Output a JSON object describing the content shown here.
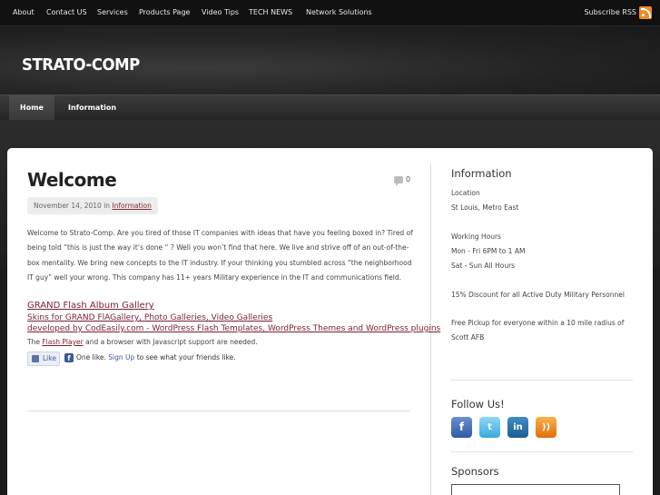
{
  "topnav": {
    "items": [
      "About",
      "Contact US",
      "Services",
      "Products Page",
      "Video Tips",
      "TECH NEWS",
      "Network Solutions"
    ],
    "subscribe": "Subscribe RSS"
  },
  "site": {
    "title": "STRATO-COMP"
  },
  "subnav": {
    "items": [
      "Home",
      "Information"
    ]
  },
  "post": {
    "title": "Welcome",
    "comments": "0",
    "date": "November 14, 2010",
    "in_word": "in",
    "category": "Information",
    "body": "Welcome to Strato-Comp. Are you tired of those IT companies with ideas that have you feeling boxed in?  Tired of being told “this is just the way it’s done “ ?  Well you won’t find that here.  We live and strive off of an out-of-the-box mentality.  We bring new concepts to the IT industry.  If your thinking you stumbled across “the neighborhood IT guy” well your wrong.  This company has 11+ years Military experience in the IT and communications field.",
    "gallery_title": "GRAND Flash Album Gallery",
    "gallery_line2": "Skins for GRAND FlAGallery, Photo Galleries, Video Galleries",
    "gallery_line3": "developed by CodEasily.com - WordPress Flash Templates, WordPress Themes and WordPress plugins",
    "flash_prefix": "The",
    "flash_link": "Flash Player",
    "flash_suffix": "and a browser with Javascript support are needed.",
    "like_label": "Like",
    "like_text": "One like.",
    "signup": "Sign Up",
    "like_suffix": "to see what your friends like."
  },
  "sidebar": {
    "info_title": "Information",
    "location_label": "Location",
    "location": "St Louis, Metro East",
    "hours_label": "Working Hours",
    "hours_weekday": "Mon - Fri 6PM to 1 AM",
    "hours_weekend": "Sat - Sun All Hours",
    "discount": "15% Discount for all Active Duty Military Personnel",
    "pickup_line1": "Free Pickup for everyone within a 10 mile radius of",
    "pickup_line2": "Scott AFB",
    "follow_title": "Follow Us!",
    "social_icons": [
      "facebook-icon",
      "twitter-icon",
      "linkedin-icon",
      "rss-icon"
    ],
    "social_glyphs": [
      "f",
      "t",
      "in",
      "))"
    ],
    "sponsors_title": "Sponsors"
  },
  "colors": {
    "link": "#7a1f2e",
    "rss": "#f08a24",
    "facebook": "#3b5998"
  }
}
